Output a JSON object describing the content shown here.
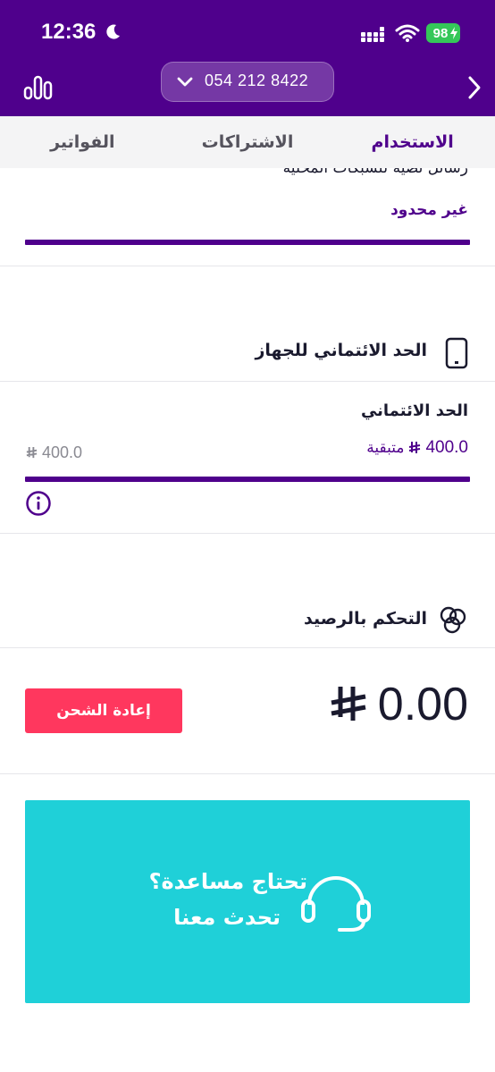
{
  "status_bar": {
    "time": "12:36",
    "battery": "98"
  },
  "header": {
    "phone_number": "054 212 8422"
  },
  "tabs": [
    {
      "label": "الاستخدام",
      "active": true
    },
    {
      "label": "الاشتراكات",
      "active": false
    },
    {
      "label": "الفواتير",
      "active": false
    }
  ],
  "usage": {
    "partial_label": "رسائل نصية للشبكات المحلية",
    "value": "غير محدود"
  },
  "credit_limit": {
    "title": "الحد الائتماني للجهاز",
    "label": "الحد الائتماني",
    "remaining_amount": "400.0",
    "remaining_suffix": "متبقية",
    "total_amount": "400.0"
  },
  "balance_control": {
    "title": "التحكم بالرصيد",
    "balance": "0.00",
    "recharge_label": "إعادة الشحن"
  },
  "help": {
    "question": "تحتاج مساعدة؟",
    "cta": "تحدث معنا"
  },
  "colors": {
    "brand": "#4f008c",
    "recharge": "#ff375e",
    "help_card": "#1fd0d8"
  }
}
